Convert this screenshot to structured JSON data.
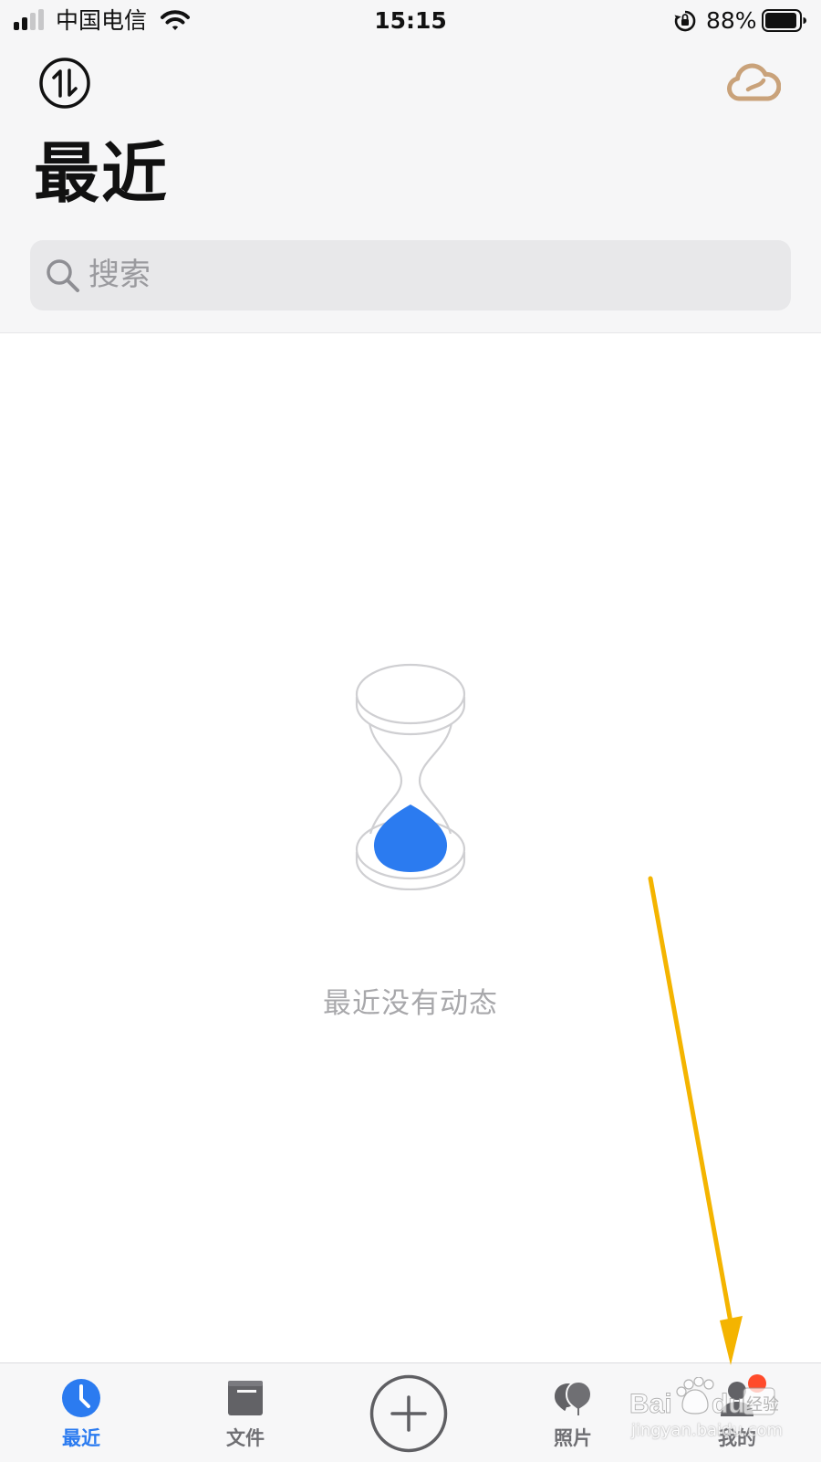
{
  "status_bar": {
    "carrier": "中国电信",
    "time": "15:15",
    "battery_percent": "88%"
  },
  "header": {
    "title": "最近",
    "transfer_icon": "transfer-icon",
    "cloud_icon": "cloud-icon"
  },
  "search": {
    "placeholder": "搜索"
  },
  "empty_state": {
    "icon": "hourglass-icon",
    "message": "最近没有动态"
  },
  "tab_bar": {
    "items": [
      {
        "label": "最近",
        "icon": "clock-icon",
        "active": true
      },
      {
        "label": "文件",
        "icon": "folder-icon",
        "active": false
      },
      {
        "label": "照片",
        "icon": "photos-icon",
        "active": false
      },
      {
        "label": "我的",
        "icon": "user-icon",
        "active": false
      }
    ],
    "center_button_icon": "plus-icon"
  },
  "overlay": {
    "watermark_logo_text": "Baidu经验",
    "watermark_url": "jingyan.baidu.com"
  },
  "colors": {
    "accent": "#2b7bf0",
    "cloud": "#c9a27a",
    "notification": "#ff4b2b",
    "arrow": "#f4b400"
  }
}
